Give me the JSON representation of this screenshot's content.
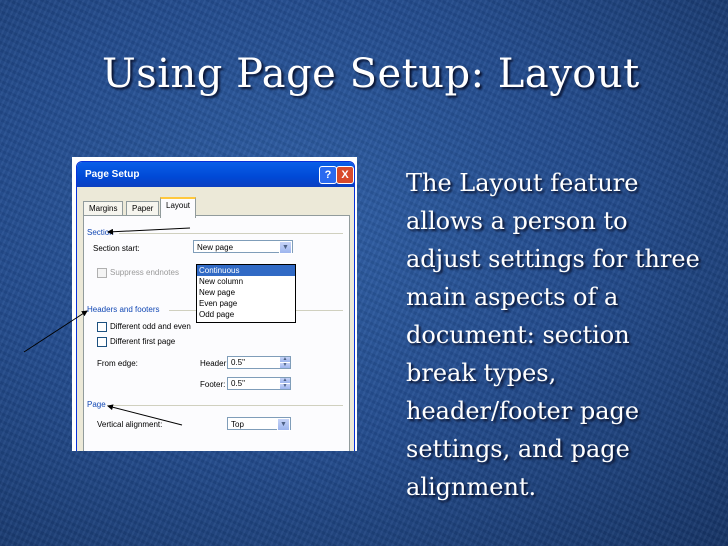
{
  "slide": {
    "title": "Using Page Setup: Layout",
    "body": "The Layout feature allows a person to adjust settings for three main aspects of a document: section break types, header/footer page settings, and page alignment."
  },
  "dialog": {
    "title": "Page Setup",
    "help_label": "?",
    "close_label": "X",
    "tabs": [
      {
        "label": "Margins",
        "active": false
      },
      {
        "label": "Paper",
        "active": false
      },
      {
        "label": "Layout",
        "active": true
      }
    ],
    "section": {
      "label": "Section",
      "start_label": "Section start:",
      "start_value": "New page",
      "options": [
        "Continuous",
        "New column",
        "New page",
        "Even page",
        "Odd page"
      ],
      "highlighted_option": "Continuous",
      "suppress_endnotes": "Suppress endnotes"
    },
    "headers_footers": {
      "label": "Headers and footers",
      "different_odd_even": "Different odd and even",
      "different_first_page": "Different first page",
      "from_edge": "From edge:",
      "header_label": "Header:",
      "header_value": "0.5\"",
      "footer_label": "Footer:",
      "footer_value": "0.5\""
    },
    "page": {
      "label": "Page",
      "vertical_alignment_label": "Vertical alignment:",
      "vertical_alignment_value": "Top"
    }
  },
  "colors": {
    "slide_background": "#234c8e",
    "title_text": "#ffffff",
    "xp_titlebar": "#0049d6",
    "group_label": "#1248b4",
    "selection": "#316ac5"
  }
}
